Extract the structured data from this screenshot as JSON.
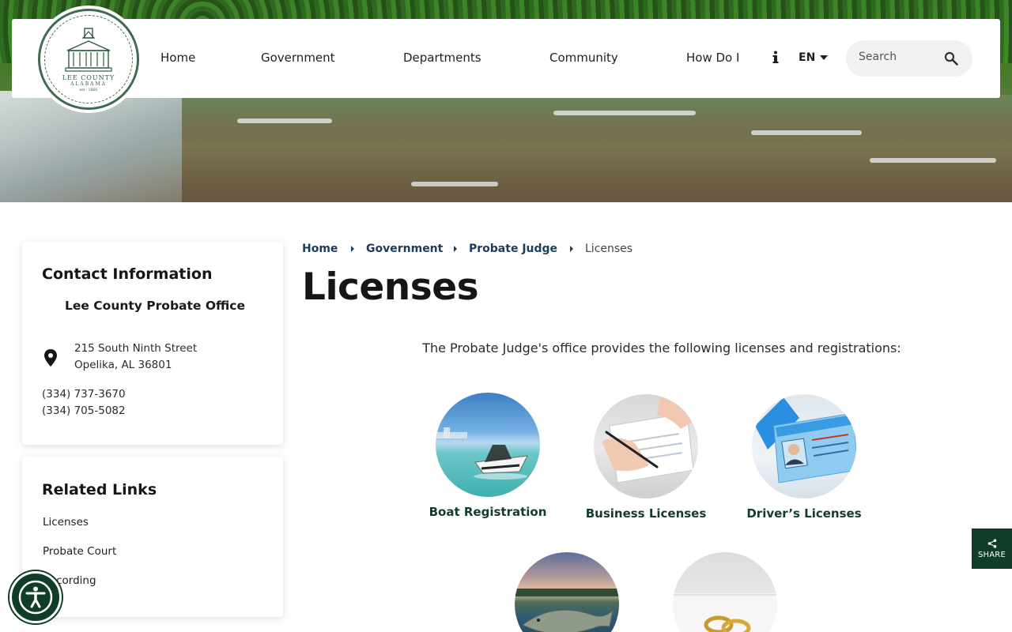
{
  "header": {
    "logo": {
      "line1": "LEE COUNTY",
      "line2": "ALABAMA",
      "est": "est · 1866"
    },
    "nav": [
      "Home",
      "Government",
      "Departments",
      "Community",
      "How Do I"
    ],
    "language": "EN",
    "search_placeholder": "Search",
    "icons": {
      "info": "info-icon",
      "search": "search-icon",
      "lang_caret": "chevron-down-icon"
    }
  },
  "contact": {
    "title": "Contact Information",
    "office": "Lee County Probate Office",
    "address_line1": "215 South Ninth Street",
    "address_line2": "Opelika, AL 36801",
    "phones": [
      "(334) 737-3670",
      "(334) 705-5082"
    ]
  },
  "related": {
    "title": "Related Links",
    "links": [
      "Licenses",
      "Probate Court",
      "Recording"
    ]
  },
  "breadcrumb": {
    "items": [
      "Home",
      "Government",
      "Probate Judge"
    ],
    "current": "Licenses"
  },
  "page": {
    "title": "Licenses",
    "intro": "The Probate Judge's office provides the following licenses and registrations:"
  },
  "tiles": [
    "Boat Registration",
    "Business Licenses",
    "Driver’s Licenses"
  ],
  "share": {
    "label": "SHARE"
  },
  "colors": {
    "brand_green": "#0f3d2a",
    "link_blue": "#1b3c5c",
    "tile_label": "#143b2b"
  }
}
